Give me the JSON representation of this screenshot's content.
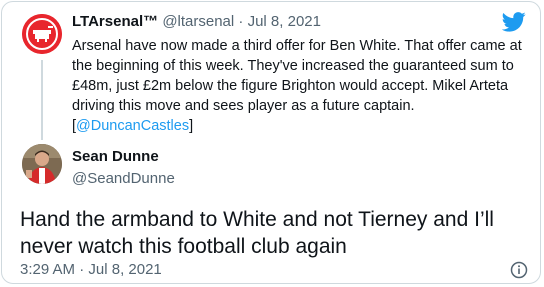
{
  "quoted_tweet": {
    "display_name": "LTArsenal™",
    "handle": "@ltarsenal",
    "separator": "·",
    "date": "Jul 8, 2021",
    "text": "Arsenal have now made a third offer for Ben White. That offer came at the beginning of this week. They've increased the guaranteed sum to £48m, just £2m below the figure Brighton would accept. Mikel Arteta driving this move and sees player as a future captain. [",
    "mention": "@DuncanCastles",
    "text_end": "]"
  },
  "tweet": {
    "display_name": "Sean Dunne",
    "handle": "@SeandDunne",
    "text": "Hand the armband to White and not Tierney and I’ll never watch this football club again",
    "time": "3:29 AM",
    "separator": "·",
    "date": "Jul 8, 2021"
  },
  "icons": {
    "brand": "twitter-bird-icon",
    "info": "info-icon"
  },
  "colors": {
    "link": "#1d9bf0",
    "secondary_text": "#536471",
    "border": "#cfd9de",
    "avatar_red": "#e8262d"
  }
}
